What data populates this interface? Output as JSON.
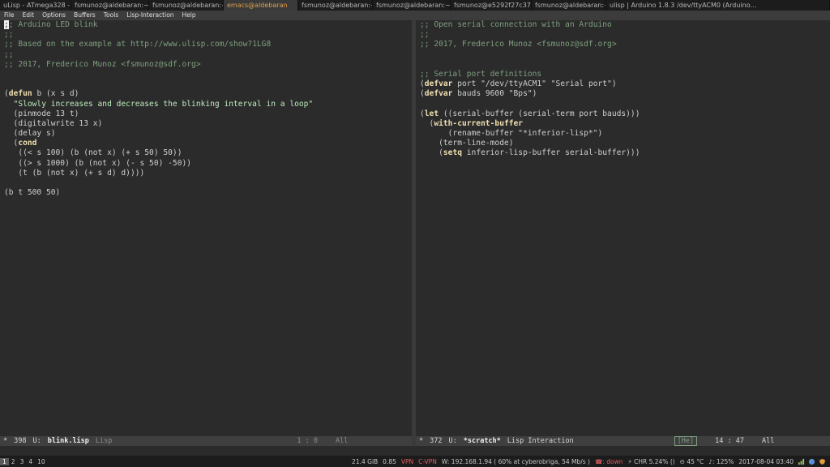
{
  "taskbar": {
    "tabs": [
      {
        "label": "uLisp - ATmega328 - fsmunoz@aldebaran:~/…"
      },
      {
        "label": "fsmunoz@aldebaran:~/…"
      },
      {
        "label": "fsmunoz@aldebaran:~"
      },
      {
        "label": "emacs@aldebaran"
      },
      {
        "label": "fsmunoz@aldebaran:~"
      },
      {
        "label": "fsmunoz@aldebaran:~/…"
      },
      {
        "label": "fsmunoz@e5292f27c372…"
      },
      {
        "label": "fsmunoz@aldebaran:~/…"
      },
      {
        "label": "ulisp | Arduino 1.8.3 /dev/ttyACM0 (Arduino…"
      }
    ]
  },
  "menubar": {
    "items": [
      "File",
      "Edit",
      "Options",
      "Buffers",
      "Tools",
      "Lisp-Interaction",
      "Help"
    ]
  },
  "left_buffer": {
    "lines": [
      ";; Arduino LED blink",
      ";;",
      ";; Based on the example at http://www.ulisp.com/show?1LG8",
      ";;",
      ";; 2017, Frederico Munoz <fsmunoz@sdf.org>",
      "",
      "",
      "(defun b (x s d)",
      "  \"Slowly increases and decreases the blinking interval in a loop\"",
      "  (pinmode 13 t)",
      "  (digitalwrite 13 x)",
      "  (delay s)",
      "  (cond",
      "   ((< s 100) (b (not x) (+ s 50) 50))",
      "   ((> s 1000) (b (not x) (- s 50) -50))",
      "   (t (b (not x) (+ s d) d))))",
      "",
      "(b t 500 50)"
    ]
  },
  "right_buffer": {
    "lines": [
      ";; Open serial connection with an Arduino",
      ";;",
      ";; 2017, Frederico Munoz <fsmunoz@sdf.org>",
      "",
      "",
      ";; Serial port definitions",
      "(defvar port \"/dev/ttyACM1\" \"Serial port\")",
      "(defvar bauds 9600 \"Bps\")",
      "",
      "(let ((serial-buffer (serial-term port bauds)))",
      "  (with-current-buffer",
      "      (rename-buffer \"*inferior-lisp*\")",
      "    (term-line-mode)",
      "    (setq inferior-lisp-buffer serial-buffer)))"
    ]
  },
  "modeline_left": {
    "status": "*",
    "size": "398",
    "encoding": "U:",
    "buffer_name": "blink.lisp",
    "mode": "Lisp",
    "position": "1 :  0",
    "scroll": "All"
  },
  "modeline_right": {
    "status": "*",
    "size": "372",
    "encoding": "U:",
    "buffer_name": "*scratch*",
    "mode": "Lisp Interaction",
    "badge": "[He]",
    "position": "14 : 47",
    "scroll": "All"
  },
  "statusbar": {
    "workspaces": [
      "1",
      "2",
      "3",
      "4",
      "10"
    ],
    "active_workspace": "1",
    "disk": "21.4 GiB",
    "load": "0.85",
    "vpn": "VPN",
    "cvpn": "C-VPN",
    "wifi": "W: 192.168.1.94 ( 60% at cyberobriga, 54 Mb/s )",
    "phone": "☎: down",
    "battery": "⚡ CHR 5.24% ()",
    "temp": "⊝ 45 °C",
    "volume": "♪: 125%",
    "datetime": "2017-08-04 03:40"
  },
  "colors": {
    "comment": "#7f9f7f",
    "keyword": "#f0dfaf",
    "string": "#cc9393",
    "background": "#2b2b2b"
  }
}
